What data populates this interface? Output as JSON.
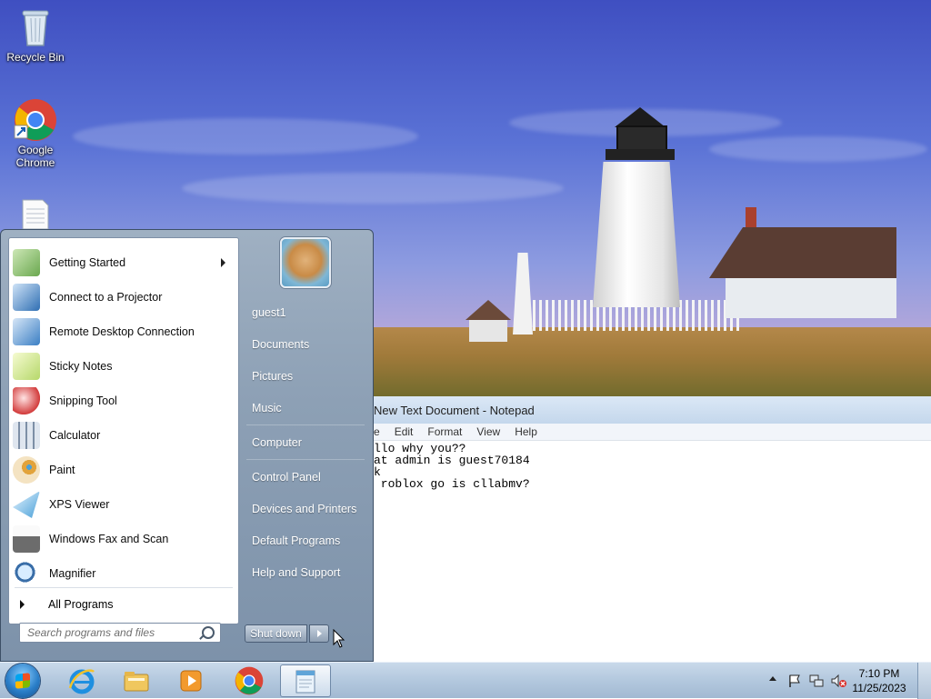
{
  "desktop": {
    "icons": [
      {
        "label": "Recycle Bin"
      },
      {
        "label": "Google\nChrome"
      }
    ]
  },
  "notepad": {
    "title": "New Text Document - Notepad",
    "menu": [
      "e",
      "Edit",
      "Format",
      "View",
      "Help"
    ],
    "lines": [
      "llo why you??",
      "at admin is guest70184",
      "k",
      " roblox go is cllabmv?"
    ]
  },
  "start_menu": {
    "programs": [
      {
        "label": "Getting Started",
        "icon": "getting-started-icon",
        "color": "#6aa84f",
        "has_submenu": true
      },
      {
        "label": "Connect to a Projector",
        "icon": "projector-icon",
        "color": "#2f6fb3",
        "has_submenu": false
      },
      {
        "label": "Remote Desktop Connection",
        "icon": "remote-desktop-icon",
        "color": "#3b7fc4",
        "has_submenu": false
      },
      {
        "label": "Sticky Notes",
        "icon": "sticky-notes-icon",
        "color": "#b6d86a",
        "has_submenu": false
      },
      {
        "label": "Snipping Tool",
        "icon": "scissors-icon",
        "color": "#d23b3b",
        "has_submenu": false
      },
      {
        "label": "Calculator",
        "icon": "calculator-icon",
        "color": "#7d8fa6",
        "has_submenu": false
      },
      {
        "label": "Paint",
        "icon": "paint-palette-icon",
        "color": "#e2a33b",
        "has_submenu": false
      },
      {
        "label": "XPS Viewer",
        "icon": "xps-viewer-icon",
        "color": "#4aa0d8",
        "has_submenu": false
      },
      {
        "label": "Windows Fax and Scan",
        "icon": "fax-icon",
        "color": "#6c6c6c",
        "has_submenu": false
      },
      {
        "label": "Magnifier",
        "icon": "magnifier-icon",
        "color": "#3a6ea8",
        "has_submenu": false
      }
    ],
    "all_programs": "All Programs",
    "search_placeholder": "Search programs and files",
    "user": "guest1",
    "links_group1": [
      "Documents",
      "Pictures",
      "Music"
    ],
    "links_group2": [
      "Computer"
    ],
    "links_group3": [
      "Control Panel",
      "Devices and Printers",
      "Default Programs",
      "Help and Support"
    ],
    "shutdown_label": "Shut down"
  },
  "taskbar": {
    "time": "7:10 PM",
    "date": "11/25/2023",
    "pinned": [
      "internet-explorer-icon",
      "file-explorer-icon",
      "media-player-icon",
      "chrome-icon",
      "notepad-icon"
    ]
  }
}
